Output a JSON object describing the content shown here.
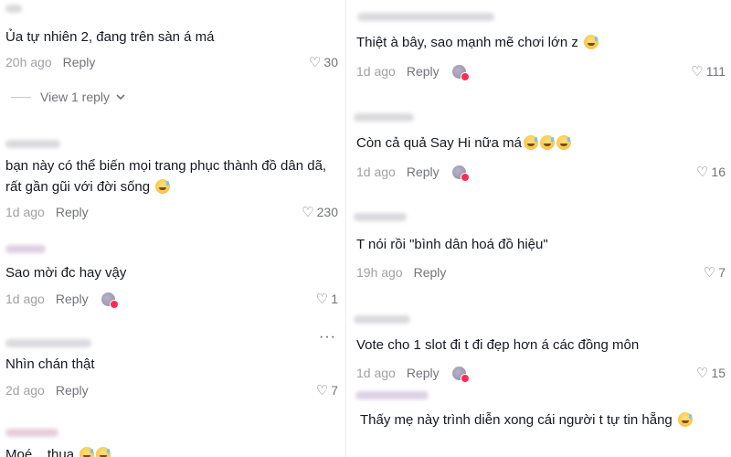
{
  "left": {
    "comments": [
      {
        "text": "Ủa tự nhiên 2, đang trên sàn á má",
        "time": "20h ago",
        "reply": "Reply",
        "likes": "30"
      },
      {
        "text": "bạn này có thể biến mọi trang phục thành đồ dân dã, rất gần gũi với đời sống",
        "time": "1d ago",
        "reply": "Reply",
        "likes": "230"
      },
      {
        "text": "Sao mời đc hay vậy",
        "time": "1d ago",
        "reply": "Reply",
        "likes": "1"
      },
      {
        "text": "Nhìn chán thật",
        "time": "2d ago",
        "reply": "Reply",
        "likes": "7"
      },
      {
        "text": "Moé....thua"
      }
    ],
    "view_reply": "View 1 reply"
  },
  "right": {
    "comments": [
      {
        "text": "Thiệt à bây, sao mạnh mẽ chơi lớn z",
        "time": "1d ago",
        "reply": "Reply",
        "likes": "111"
      },
      {
        "text": "Còn cả quả Say Hi nữa má",
        "time": "1d ago",
        "reply": "Reply",
        "likes": "16"
      },
      {
        "text": "T nói rồi \"bình dân hoá đồ hiệu\"",
        "time": "19h ago",
        "reply": "Reply",
        "likes": "7"
      },
      {
        "text": "Vote cho 1 slot đi t đi đẹp hơn á các đồng môn",
        "time": "1d ago",
        "reply": "Reply",
        "likes": "15"
      },
      {
        "text": "Thấy mẹ này trình diễn xong cái người t tự tin hẵng"
      }
    ]
  },
  "icons": {
    "like": "heart-icon",
    "more": "more-options-icon",
    "chevron": "chevron-down-icon"
  },
  "colors": {
    "accent": "#fe2c55",
    "text": "#161823",
    "meta": "#8a8b91"
  }
}
